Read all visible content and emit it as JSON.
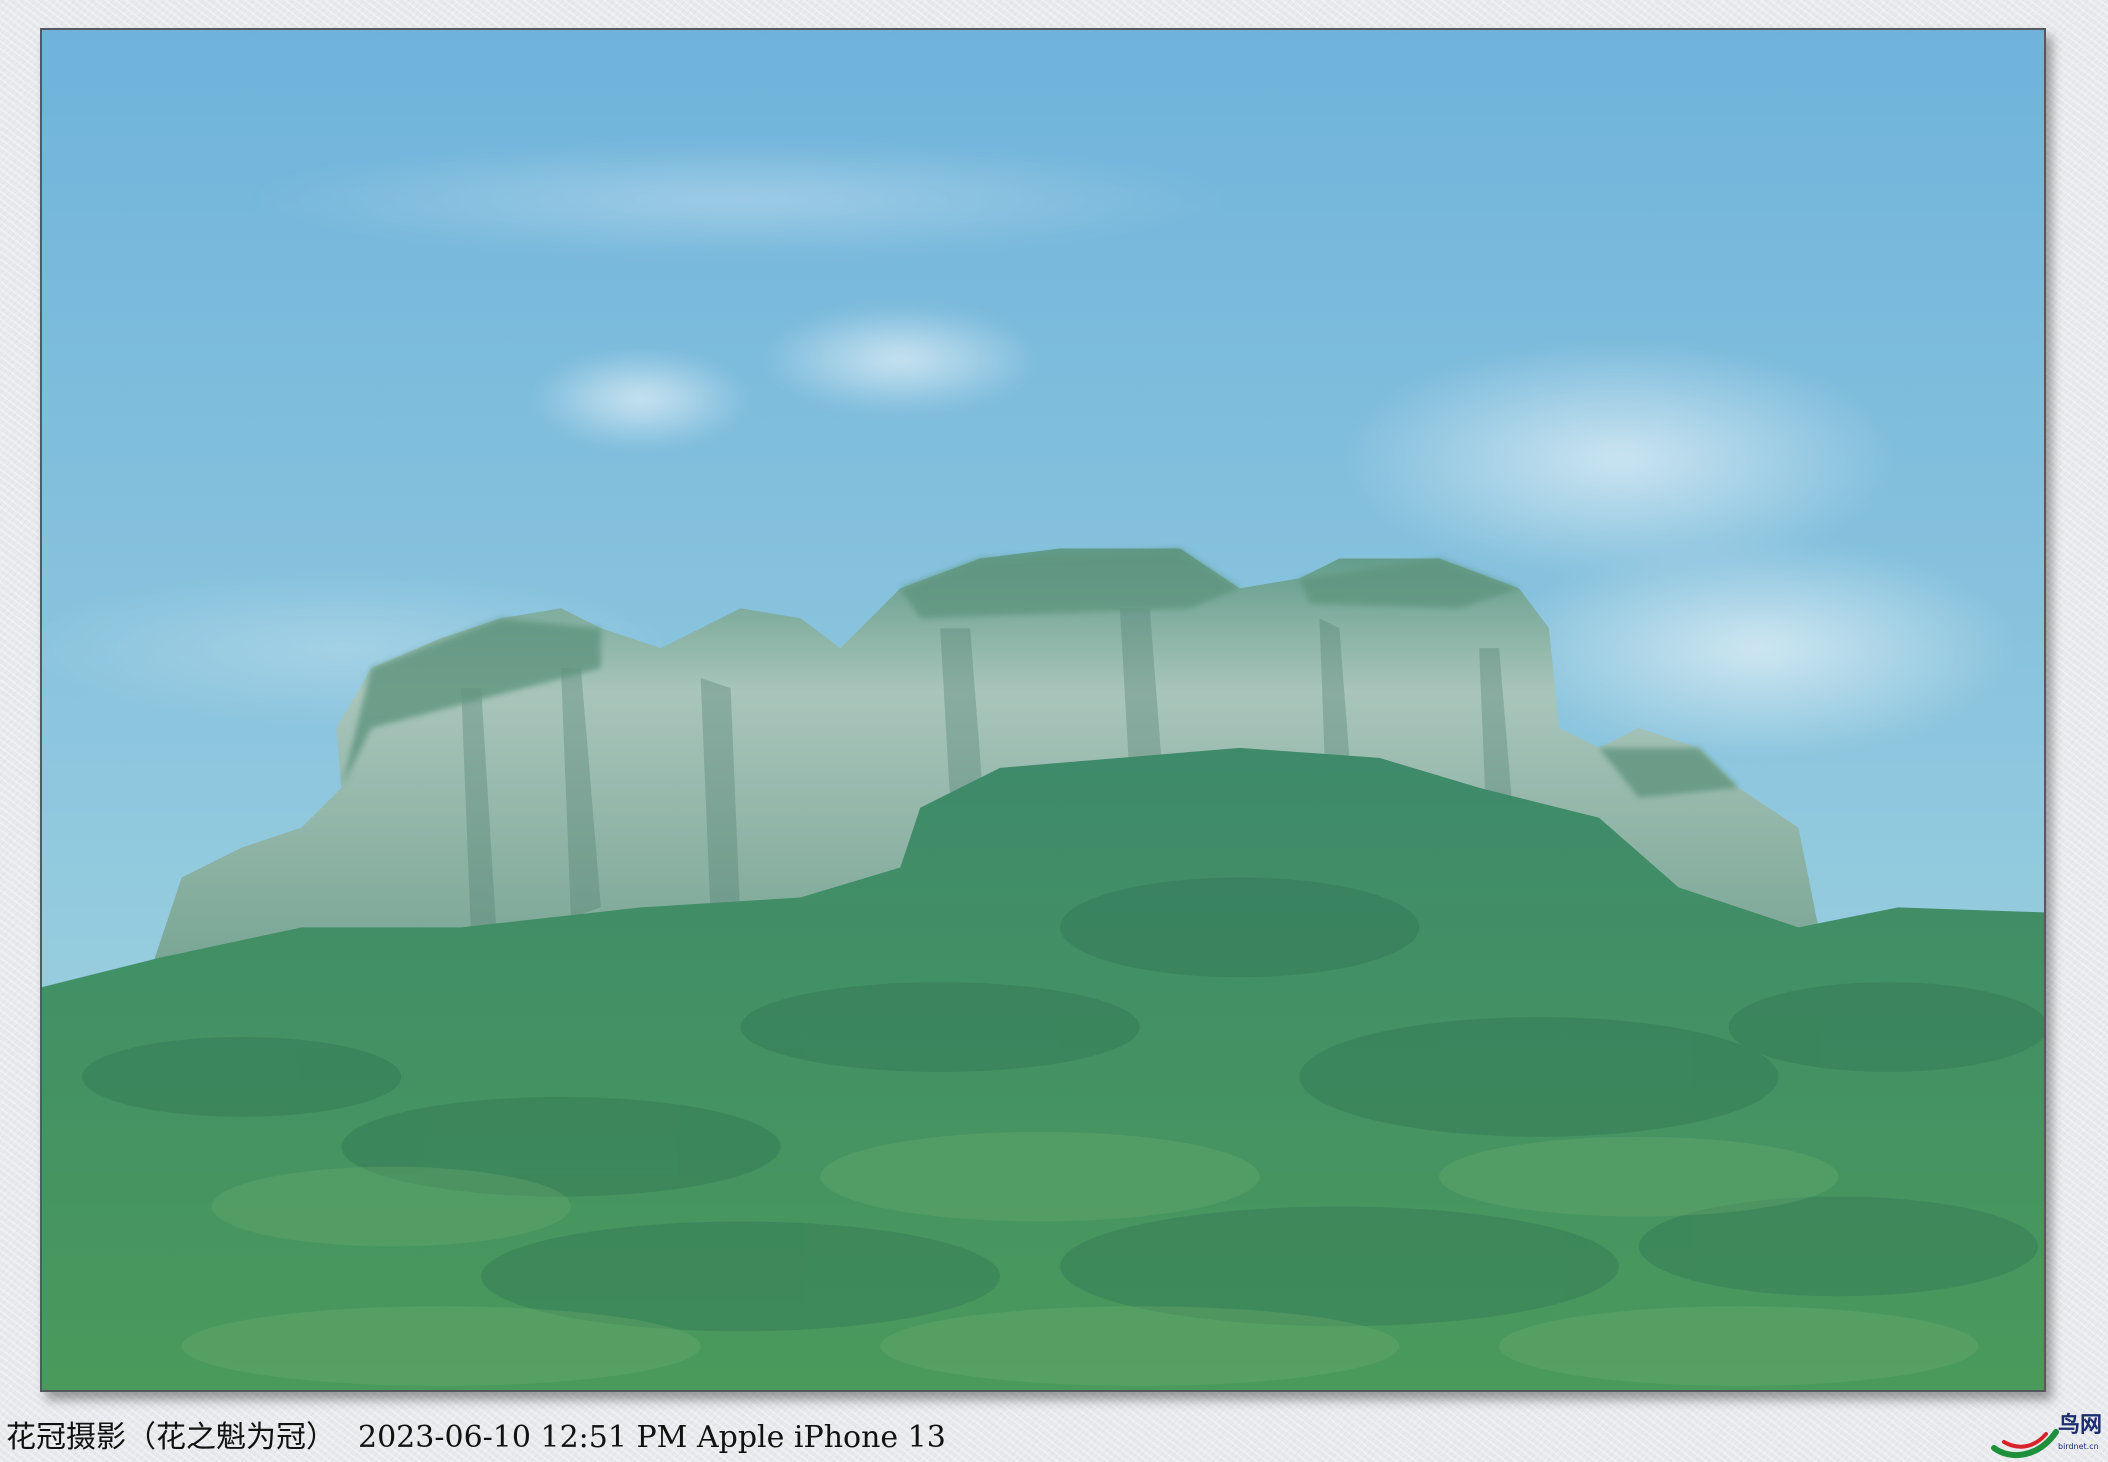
{
  "caption": {
    "studio": "花冠摄影（花之魁为冠）",
    "datetime": "2023-06-10 12:51 PM",
    "camera": "Apple iPhone 13"
  },
  "watermark": {
    "logo_text": "鸟网",
    "logo_url": "birdnet.cn",
    "logo_colors": [
      "#1e8f3a",
      "#d8232a"
    ]
  },
  "photo": {
    "sky_top": "#74b7db",
    "sky_bottom": "#9fd2dc",
    "cliff": "#9fbcb0",
    "forest": "#3f8f6e"
  }
}
